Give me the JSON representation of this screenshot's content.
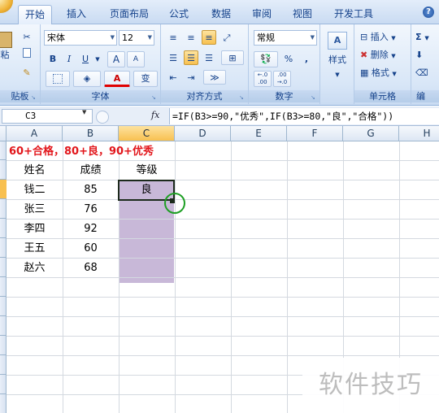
{
  "ribbon": {
    "tabs": [
      "开始",
      "插入",
      "页面布局",
      "公式",
      "数据",
      "审阅",
      "视图",
      "开发工具"
    ],
    "active_tab": "开始",
    "groups": {
      "clipboard": {
        "label": "贴板",
        "paste_label": "粘"
      },
      "font": {
        "label": "字体",
        "font_name": "宋体",
        "font_size": "12",
        "bold": "B",
        "italic": "I",
        "underline": "U",
        "grow": "A",
        "shrink": "A",
        "font_color": "A",
        "phonetic": "变"
      },
      "alignment": {
        "label": "对齐方式"
      },
      "number": {
        "label": "数字",
        "format": "常规",
        "percent": "%",
        "comma": ",",
        "inc_decimal": "←.0 .00",
        "dec_decimal": ".00 →.0"
      },
      "styles": {
        "label": "样式"
      },
      "cells": {
        "label": "单元格",
        "insert": "插入",
        "delete": "删除",
        "format": "格式"
      },
      "editing": {
        "label": "编",
        "sum": "Σ"
      }
    }
  },
  "formula_bar": {
    "name_box": "C3",
    "fx": "fx",
    "formula": "=IF(B3>=90,\"优秀\",IF(B3>=80,\"良\",\"合格\"))"
  },
  "sheet": {
    "columns": [
      "A",
      "B",
      "C",
      "D",
      "E",
      "F",
      "G",
      "H"
    ],
    "selected_column": "C",
    "note": "60+合格，80+良，90+优秀",
    "headers": {
      "name": "姓名",
      "score": "成绩",
      "grade": "等级"
    },
    "rows": [
      {
        "name": "钱二",
        "score": "85",
        "grade": "良"
      },
      {
        "name": "张三",
        "score": "76",
        "grade": ""
      },
      {
        "name": "李四",
        "score": "92",
        "grade": ""
      },
      {
        "name": "王五",
        "score": "60",
        "grade": ""
      },
      {
        "name": "赵六",
        "score": "68",
        "grade": ""
      }
    ]
  },
  "watermark": "软件技巧",
  "colors": {
    "note_text": "#e2161b",
    "fill_range": "#c8b8d8",
    "highlight_circle": "#1e9f24"
  }
}
